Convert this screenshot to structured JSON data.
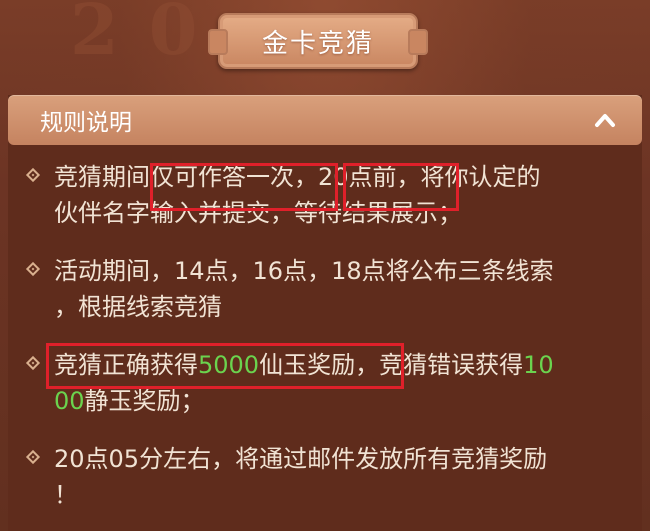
{
  "banner": {
    "title": "金卡竞猜"
  },
  "card": {
    "header_title": "规则说明",
    "collapse_icon": "chevron-up-icon"
  },
  "rules": [
    {
      "line1": "竞猜期间仅可作答一次，20点前，将你认定的",
      "line2": "伙伴名字输入并提交，等待结果展示；"
    },
    {
      "line1": "活动期间，14点，16点，18点将公布三条线索",
      "line2": "，根据线索竞猜"
    },
    {
      "line1_a": "竞猜正确获得",
      "line1_b": "5000",
      "line1_c": "仙玉奖励，竞猜错误获得",
      "line1_d": "10",
      "line2_a": "00",
      "line2_b": "静玉奖励；"
    },
    {
      "line1": "20点05分左右，将通过邮件发放所有竞猜奖励",
      "line2": "！"
    }
  ],
  "colors": {
    "highlight_box": "#e0202a",
    "green_number": "#6bd34e",
    "body_text": "#f1e3d4",
    "header_bg": "#d9a07c"
  }
}
